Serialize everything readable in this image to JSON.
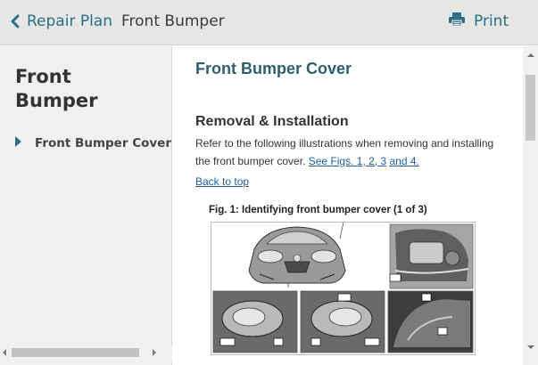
{
  "header": {
    "back_label": "Repair Plan",
    "breadcrumb": "Front Bumper",
    "print_label": "Print"
  },
  "sidebar": {
    "title": "Front Bumper",
    "items": [
      {
        "label": "Front Bumper Cover"
      }
    ]
  },
  "content": {
    "title": "Front Bumper Cover",
    "section_title": "Removal & Installation",
    "paragraph_text": "Refer to the following illustrations when removing and installing the front bumper cover.",
    "figure_links": [
      "See Figs. 1",
      ", 2",
      ", 3",
      "and 4."
    ],
    "back_to_top": "Back to top",
    "figure_caption": "Fig. 1: Identifying front bumper cover (1 of 3)",
    "figure_labels": [
      "1",
      "2",
      "3",
      "4",
      "5",
      "6",
      "7",
      "8",
      "9",
      "10",
      "11"
    ]
  },
  "colors": {
    "accent": "#2c6e84",
    "link": "#1f5fa0",
    "header_bg": "#e6e6e6",
    "sidebar_bg": "#f0f0f0"
  }
}
